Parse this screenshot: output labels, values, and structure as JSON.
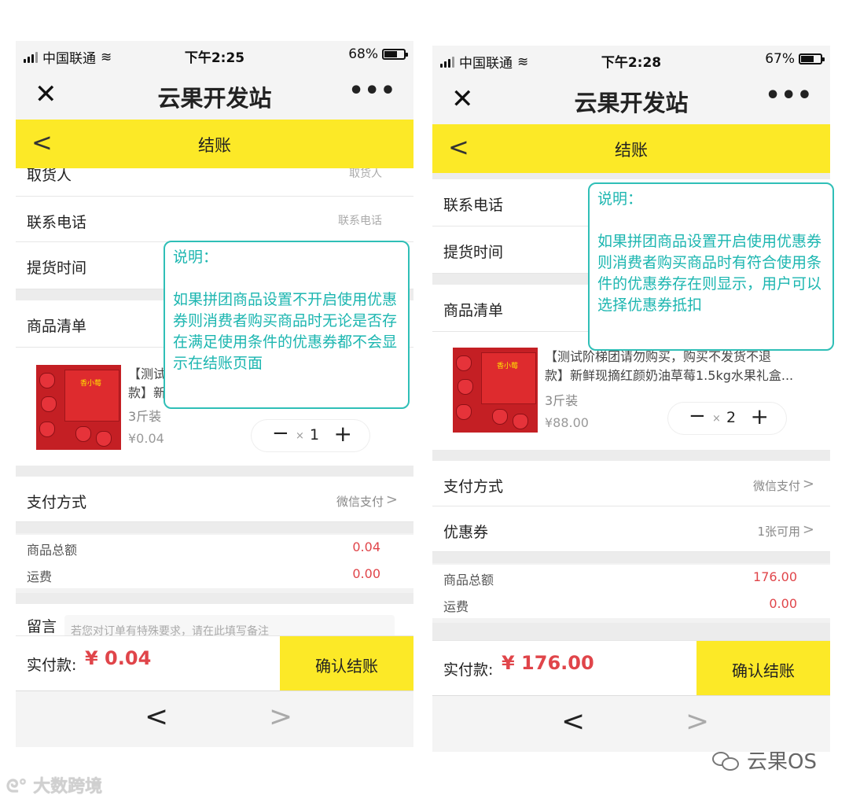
{
  "left": {
    "status": {
      "carrier": "中国联通",
      "time": "下午2:25",
      "battery": "68%",
      "battery_level": 0.68
    },
    "title": "云果开发站",
    "more": "•••",
    "header": "结账",
    "rows": {
      "receiver": {
        "label": "取货人",
        "placeholder": "取货人"
      },
      "phone": {
        "label": "联系电话",
        "placeholder": "联系电话"
      },
      "pickup": {
        "label": "提货时间"
      },
      "items": {
        "label": "商品清单"
      }
    },
    "product": {
      "name_line1": "【测试",
      "name_line2": "款】新",
      "spec": "3斤装",
      "price": "¥0.04",
      "qty": "1"
    },
    "payment": {
      "label": "支付方式",
      "value": "微信支付"
    },
    "summary": {
      "subtotal_label": "商品总额",
      "subtotal": "0.04",
      "shipping_label": "运费",
      "shipping": "0.00"
    },
    "note": {
      "label": "留言",
      "placeholder": "若您对订单有特殊要求，请在此填写备注"
    },
    "footer": {
      "label": "实付款:",
      "amount": "¥ 0.04",
      "confirm": "确认结账"
    },
    "callout": {
      "title": "说明：",
      "body": "如果拼团商品设置不开启使用优惠券则消费者购买商品时无论是否存在满足使用条件的优惠券都不会显示在结账页面"
    }
  },
  "right": {
    "status": {
      "carrier": "中国联通",
      "time": "下午2:28",
      "battery": "67%",
      "battery_level": 0.67
    },
    "title": "云果开发站",
    "more": "•••",
    "header": "结账",
    "rows": {
      "phone": {
        "label": "联系电话"
      },
      "pickup": {
        "label": "提货时间"
      },
      "items": {
        "label": "商品清单"
      }
    },
    "product": {
      "name_line1": "【测试阶梯团请勿购买，购买不发货不退",
      "name_line2": "款】新鲜现摘红颜奶油草莓1.5kg水果礼盒...",
      "spec": "3斤装",
      "price": "¥88.00",
      "qty": "2"
    },
    "payment": {
      "label": "支付方式",
      "value": "微信支付"
    },
    "coupon": {
      "label": "优惠券",
      "value": "1张可用"
    },
    "summary": {
      "subtotal_label": "商品总额",
      "subtotal": "176.00",
      "shipping_label": "运费",
      "shipping": "0.00"
    },
    "footer": {
      "label": "实付款:",
      "amount": "¥ 176.00",
      "confirm": "确认结账"
    },
    "callout": {
      "title": "说明：",
      "body": "如果拼团商品设置开启使用优惠券则消费者购买商品时有符合使用条件的优惠券存在则显示，用户可以选择优惠券抵扣"
    }
  },
  "watermarks": {
    "left": "大数跨境",
    "right": "云果OS"
  },
  "colors": {
    "accent_yellow": "#fce927",
    "price_red": "#e0454a",
    "callout_teal": "#1cb6b0"
  }
}
